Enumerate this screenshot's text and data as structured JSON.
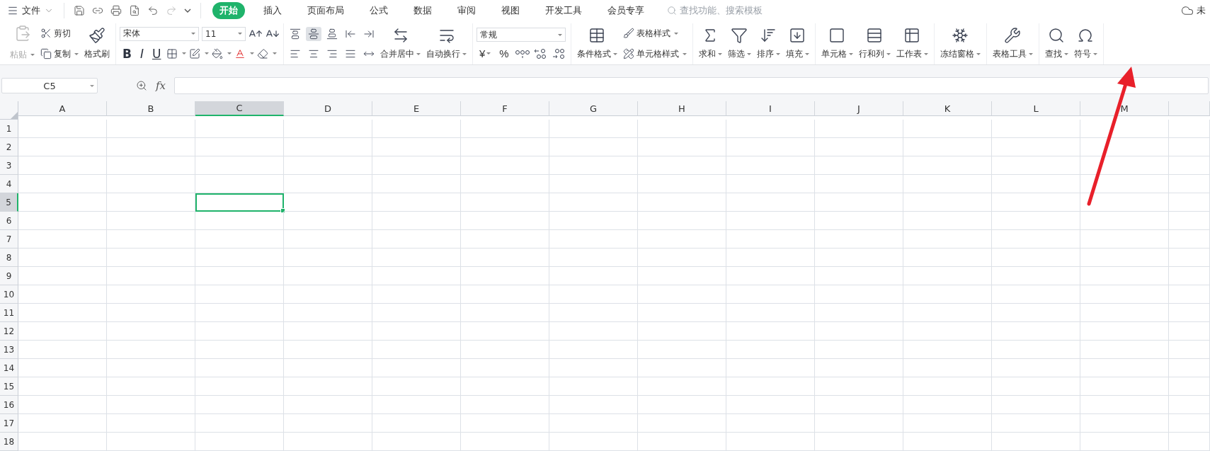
{
  "menu": {
    "label": "文件"
  },
  "tabs": [
    {
      "label": "开始",
      "selected": true
    },
    {
      "label": "插入",
      "selected": false
    },
    {
      "label": "页面布局",
      "selected": false
    },
    {
      "label": "公式",
      "selected": false
    },
    {
      "label": "数据",
      "selected": false
    },
    {
      "label": "审阅",
      "selected": false
    },
    {
      "label": "视图",
      "selected": false
    },
    {
      "label": "开发工具",
      "selected": false
    },
    {
      "label": "会员专享",
      "selected": false
    }
  ],
  "search": {
    "placeholder": "查找功能、搜索模板"
  },
  "cloud_status": "未",
  "clipboard": {
    "paste": {
      "label": "粘贴",
      "disabled": true
    },
    "cut": "剪切",
    "copy": "复制",
    "painter": "格式刷"
  },
  "font": {
    "name": "宋体",
    "size": "11",
    "styles": [
      "B",
      "I",
      "U"
    ]
  },
  "alignment": [
    {
      "kind": "top",
      "selected": false
    },
    {
      "kind": "middle",
      "selected": true
    },
    {
      "kind": "bottom",
      "selected": false
    },
    {
      "kind": "outdent",
      "selected": false
    },
    {
      "kind": "indent",
      "selected": false
    },
    {
      "kind": "left",
      "selected": false
    },
    {
      "kind": "center",
      "selected": false
    },
    {
      "kind": "right",
      "selected": false
    },
    {
      "kind": "justify",
      "selected": false
    },
    {
      "kind": "distributed",
      "selected": false
    }
  ],
  "merge": [
    {
      "kind": "merge",
      "label": "合并居中"
    },
    {
      "kind": "wrap",
      "label": "自动换行"
    }
  ],
  "number": {
    "format": "常规",
    "currency": "¥",
    "percent": "%"
  },
  "styles": {
    "conditional": "条件格式",
    "table_style": "表格样式",
    "cell_style": "单元格样式"
  },
  "tools": [
    {
      "kind": "sum",
      "label": "求和"
    },
    {
      "kind": "filter",
      "label": "筛选"
    },
    {
      "kind": "sort",
      "label": "排序"
    },
    {
      "kind": "fill",
      "label": "填充"
    },
    {
      "kind": "divider"
    },
    {
      "kind": "cell",
      "label": "单元格"
    },
    {
      "kind": "rowcol",
      "label": "行和列"
    },
    {
      "kind": "sheet",
      "label": "工作表"
    },
    {
      "kind": "divider"
    },
    {
      "kind": "freeze",
      "label": "冻结窗格"
    },
    {
      "kind": "divider"
    },
    {
      "kind": "tabletools",
      "label": "表格工具"
    },
    {
      "kind": "divider"
    },
    {
      "kind": "find",
      "label": "查找"
    },
    {
      "kind": "symbol",
      "label": "符号"
    }
  ],
  "name_box": "C5",
  "formula_label": "fx",
  "columns": [
    {
      "label": "A",
      "selected": false
    },
    {
      "label": "B",
      "selected": false
    },
    {
      "label": "C",
      "selected": true
    },
    {
      "label": "D",
      "selected": false
    },
    {
      "label": "E",
      "selected": false
    },
    {
      "label": "F",
      "selected": false
    },
    {
      "label": "G",
      "selected": false
    },
    {
      "label": "H",
      "selected": false
    },
    {
      "label": "I",
      "selected": false
    },
    {
      "label": "J",
      "selected": false
    },
    {
      "label": "K",
      "selected": false
    },
    {
      "label": "L",
      "selected": false
    },
    {
      "label": "M",
      "selected": false
    }
  ],
  "rows": [
    {
      "label": "1",
      "selected": false
    },
    {
      "label": "2",
      "selected": false
    },
    {
      "label": "3",
      "selected": false
    },
    {
      "label": "4",
      "selected": false
    },
    {
      "label": "5",
      "selected": true
    },
    {
      "label": "6",
      "selected": false
    },
    {
      "label": "7",
      "selected": false
    },
    {
      "label": "8",
      "selected": false
    },
    {
      "label": "9",
      "selected": false
    },
    {
      "label": "10",
      "selected": false
    },
    {
      "label": "11",
      "selected": false
    },
    {
      "label": "12",
      "selected": false
    },
    {
      "label": "13",
      "selected": false
    },
    {
      "label": "14",
      "selected": false
    },
    {
      "label": "15",
      "selected": false
    },
    {
      "label": "16",
      "selected": false
    },
    {
      "label": "17",
      "selected": false
    },
    {
      "label": "18",
      "selected": false
    }
  ]
}
